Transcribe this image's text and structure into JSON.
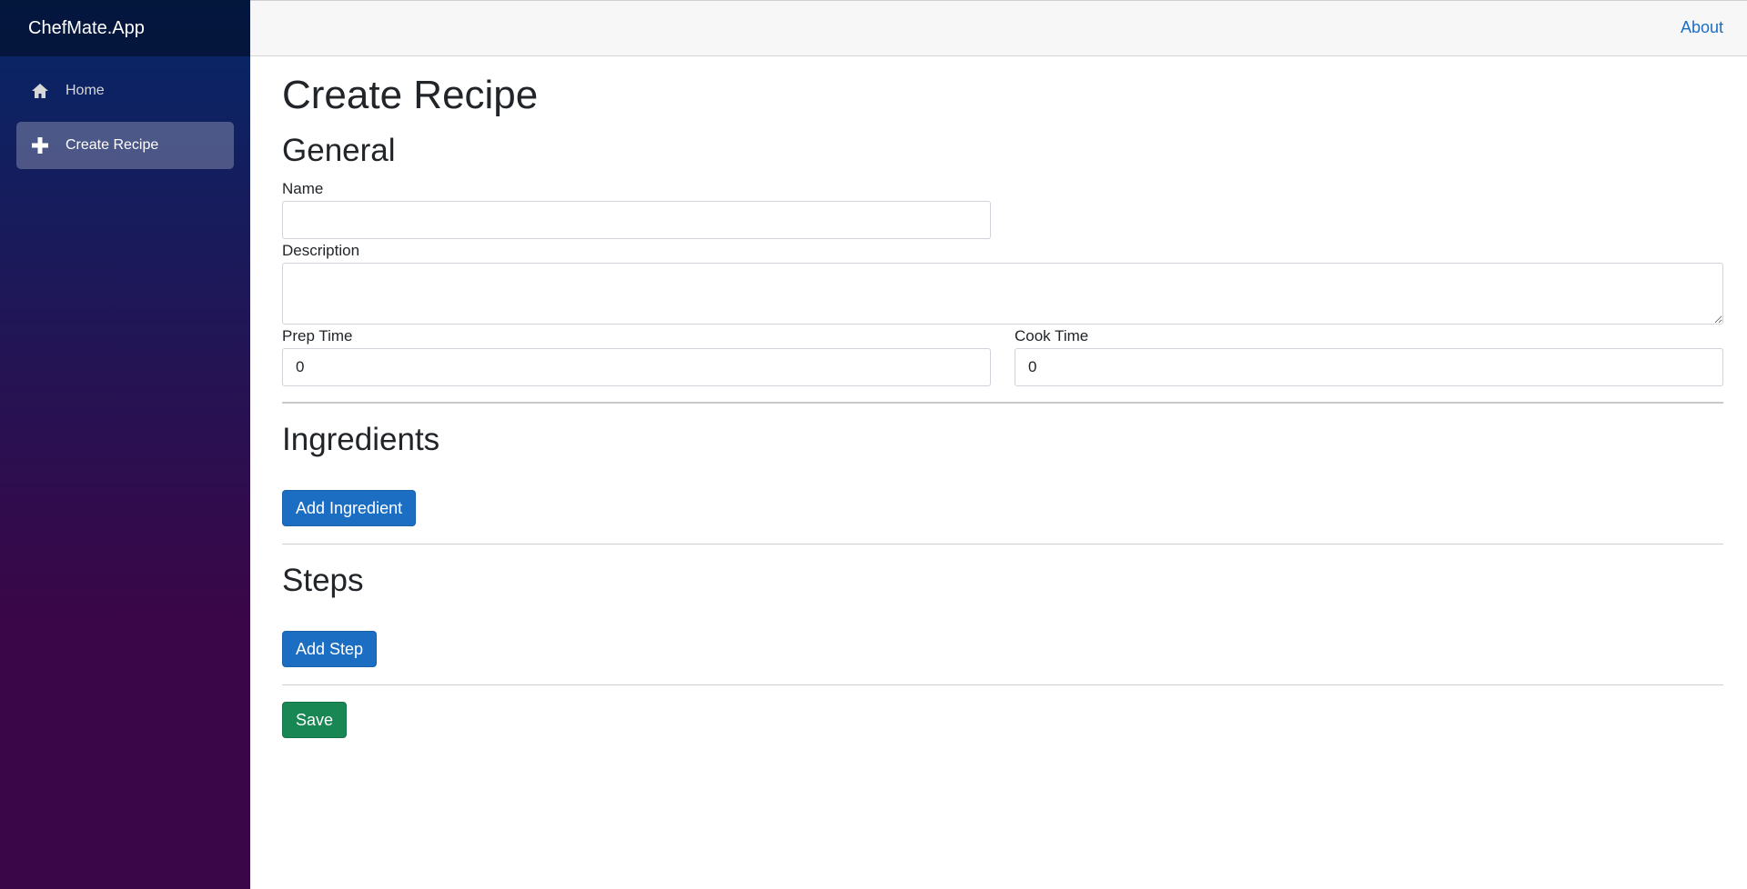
{
  "app": {
    "brand": "ChefMate.App"
  },
  "topbar": {
    "about_label": "About"
  },
  "sidebar": {
    "items": [
      {
        "label": "Home",
        "icon": "home-icon",
        "active": false
      },
      {
        "label": "Create Recipe",
        "icon": "plus-icon",
        "active": true
      }
    ]
  },
  "page": {
    "title": "Create Recipe",
    "general": {
      "heading": "General",
      "name_label": "Name",
      "name_value": "",
      "description_label": "Description",
      "description_value": "",
      "prep_time_label": "Prep Time",
      "prep_time_value": "0",
      "cook_time_label": "Cook Time",
      "cook_time_value": "0"
    },
    "ingredients": {
      "heading": "Ingredients",
      "add_label": "Add Ingredient"
    },
    "steps": {
      "heading": "Steps",
      "add_label": "Add Step"
    },
    "save_label": "Save"
  },
  "colors": {
    "sidebar_gradient_top": "#052767",
    "sidebar_gradient_bottom": "#3a0647",
    "primary": "#1b6ec2",
    "success": "#198754"
  }
}
